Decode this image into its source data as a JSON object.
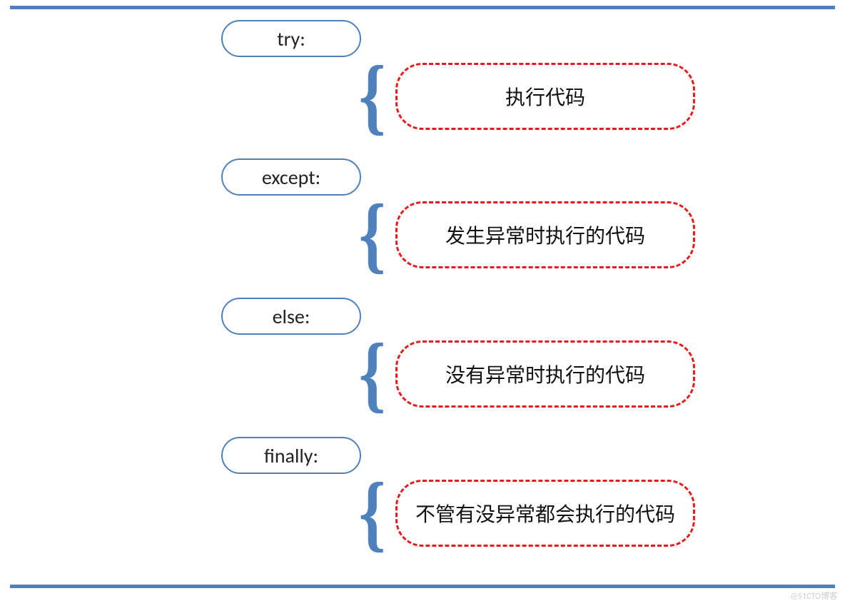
{
  "blocks": [
    {
      "keyword": "try:",
      "description": "执行代码"
    },
    {
      "keyword": "except:",
      "description": "发生异常时执行的代码"
    },
    {
      "keyword": "else:",
      "description": "没有异常时执行的代码"
    },
    {
      "keyword": "finally:",
      "description": "不管有没异常都会执行的代码"
    }
  ],
  "brace_glyph": "{",
  "watermark": "@51CTO博客"
}
